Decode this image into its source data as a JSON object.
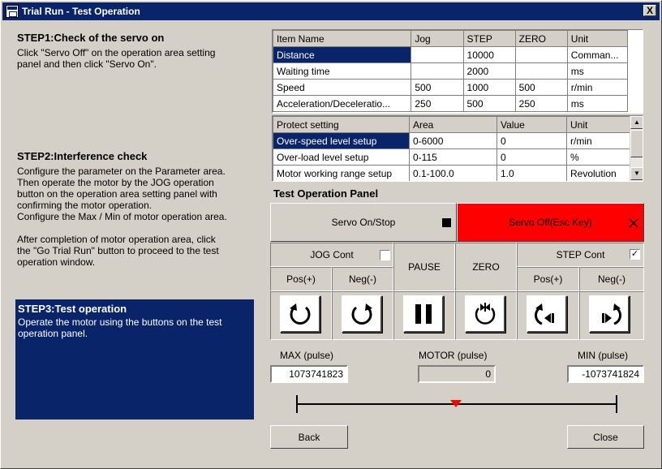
{
  "window": {
    "title": "Trial Run - Test Operation",
    "close_glyph": "X"
  },
  "steps": {
    "step1": {
      "title": "STEP1:Check of the servo on",
      "text": "Click \"Servo Off\" on the operation area setting\npanel and then click \"Servo On\"."
    },
    "step2": {
      "title": "STEP2:Interference check",
      "text": "Configure the parameter on the Parameter area.\nThen operate the motor by the JOG operation\nbutton on the operation area setting panel with\nconfirming the motor operation.\nConfigure the Max / Min of motor operation area.\n\nAfter completion of motor operation area, click\nthe \"Go Trial Run\" button to proceed to the test\noperation window."
    },
    "step3": {
      "title": "STEP3:Test operation",
      "text": "Operate the motor using the buttons on the test\noperation panel."
    }
  },
  "param_table": {
    "headers": [
      "Item Name",
      "Jog",
      "STEP",
      "ZERO",
      "Unit"
    ],
    "rows": [
      [
        "Distance",
        "",
        "10000",
        "",
        "Comman..."
      ],
      [
        "Waiting time",
        "",
        "2000",
        "",
        "ms"
      ],
      [
        "Speed",
        "500",
        "1000",
        "500",
        "r/min"
      ],
      [
        "Acceleration/Deceleratio...",
        "250",
        "500",
        "250",
        "ms"
      ]
    ]
  },
  "protect_table": {
    "headers": [
      "Protect setting",
      "Area",
      "Value",
      "Unit"
    ],
    "rows": [
      [
        "Over-speed level setup",
        "0-6000",
        "0",
        "r/min"
      ],
      [
        "Over-load level setup",
        "0-115",
        "0",
        "%"
      ],
      [
        "Motor working range setup",
        "0.1-100.0",
        "1.0",
        "Revolution"
      ]
    ]
  },
  "panel": {
    "title": "Test Operation Panel",
    "servo_on_label": "Servo On/Stop",
    "servo_off_label": "Servo Off(Esc Key)",
    "servo_off_color": "#ff0000",
    "jog_cont_label": "JOG Cont",
    "jog_cont_checked": false,
    "step_cont_label": "STEP Cont",
    "step_cont_checked": true,
    "check_mark": "✓",
    "pause_label": "PAUSE",
    "zero_label": "ZERO",
    "pos_label": "Pos(+)",
    "neg_label": "Neg(-)",
    "icons": [
      "rotate-ccw-icon",
      "rotate-cw-icon",
      "pause-icon",
      "zero-return-icon",
      "step-ccw-icon",
      "step-cw-icon"
    ]
  },
  "range": {
    "max_label": "MAX (pulse)",
    "motor_label": "MOTOR (pulse)",
    "min_label": "MIN (pulse)",
    "max_value": "1073741823",
    "motor_value": "0",
    "min_value": "-1073741824"
  },
  "footer": {
    "back_label": "Back",
    "close_label": "Close"
  }
}
